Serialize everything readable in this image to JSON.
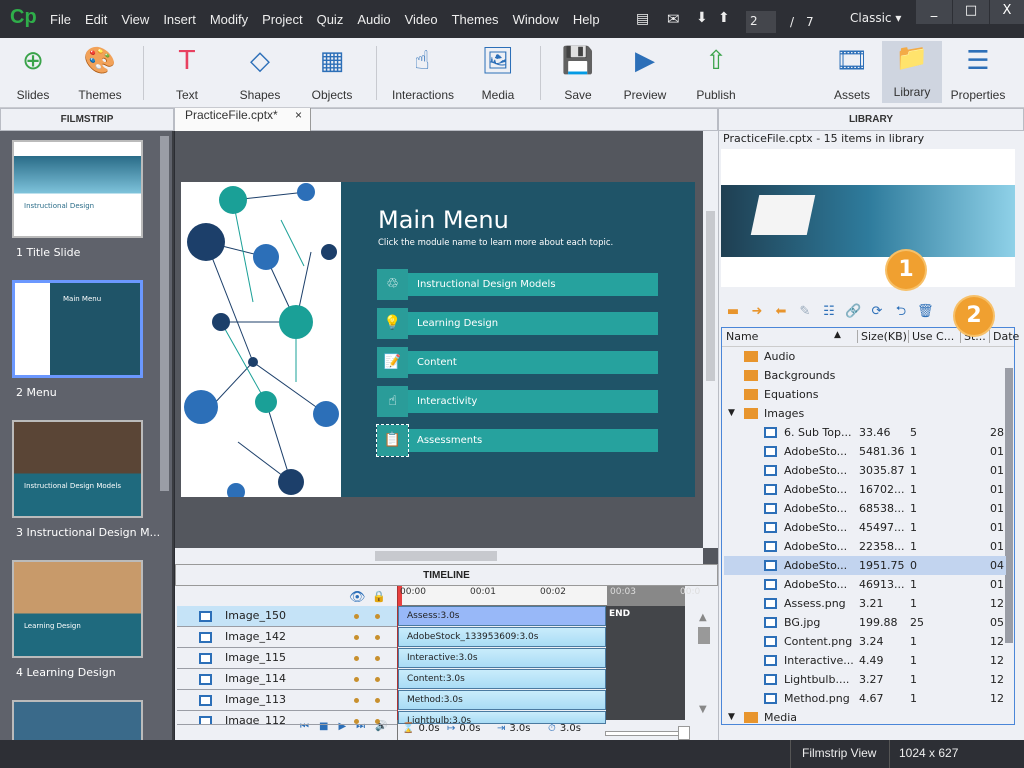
{
  "app": {
    "logo": "Cp",
    "menu": [
      "File",
      "Edit",
      "View",
      "Insert",
      "Modify",
      "Project",
      "Quiz",
      "Audio",
      "Video",
      "Themes",
      "Window",
      "Help"
    ],
    "page_current": "2",
    "page_sep": "/",
    "page_total": "7",
    "workspace": "Classic",
    "win": [
      "_",
      "□",
      "X"
    ]
  },
  "toolbar": {
    "items": [
      {
        "label": "Slides",
        "icon": "plus-circle-icon"
      },
      {
        "label": "Themes",
        "icon": "palette-icon"
      },
      {
        "label": "Text",
        "icon": "text-icon"
      },
      {
        "label": "Shapes",
        "icon": "shapes-icon"
      },
      {
        "label": "Objects",
        "icon": "objects-icon"
      },
      {
        "label": "Interactions",
        "icon": "hand-pointer-icon"
      },
      {
        "label": "Media",
        "icon": "image-icon"
      },
      {
        "label": "Save",
        "icon": "floppy-icon"
      },
      {
        "label": "Preview",
        "icon": "play-icon"
      },
      {
        "label": "Publish",
        "icon": "publish-icon"
      },
      {
        "label": "Assets",
        "icon": "assets-icon"
      },
      {
        "label": "Library",
        "icon": "library-icon"
      },
      {
        "label": "Properties",
        "icon": "properties-icon"
      }
    ]
  },
  "panels": {
    "filmstrip": "FILMSTRIP",
    "tab": "PracticeFile.cptx*",
    "tab_close": "×",
    "library": "LIBRARY",
    "timeline": "TIMELINE"
  },
  "filmstrip": [
    {
      "label": "1 Title Slide",
      "thumb_title": "Instructional Design"
    },
    {
      "label": "2 Menu",
      "thumb_title": "Main Menu"
    },
    {
      "label": "3 Instructional Design M...",
      "thumb_title": "Instructional Design Models"
    },
    {
      "label": "4 Learning Design",
      "thumb_title": "Learning Design"
    }
  ],
  "slide": {
    "title": "Main Menu",
    "subtitle": "Click the module name to learn more about each topic.",
    "buttons": [
      "Instructional Design Models",
      "Learning Design",
      "Content",
      "Interactivity",
      "Assessments"
    ]
  },
  "timeline": {
    "ticks": [
      "00:00",
      "00:01",
      "00:02",
      "00:03",
      "00:0"
    ],
    "end": "END",
    "rows": [
      {
        "name": "Image_150",
        "bar": "Assess:3.0s"
      },
      {
        "name": "Image_142",
        "bar": "AdobeStock_133953609:3.0s"
      },
      {
        "name": "Image_115",
        "bar": "Interactive:3.0s"
      },
      {
        "name": "Image_114",
        "bar": "Content:3.0s"
      },
      {
        "name": "Image_113",
        "bar": "Method:3.0s"
      },
      {
        "name": "Image_112",
        "bar": "Lightbulb:3.0s"
      }
    ],
    "times": [
      "0.0s",
      "0.0s",
      "3.0s",
      "3.0s"
    ]
  },
  "library": {
    "summary": "PracticeFile.cptx - 15 items in library",
    "columns": [
      "Name",
      "Size(KB)",
      "Use C...",
      "St...",
      "Date"
    ],
    "folders": [
      "Audio",
      "Backgrounds",
      "Equations",
      "Images"
    ],
    "items": [
      [
        "6. Sub Top...",
        "33.46",
        "5",
        "28"
      ],
      [
        "AdobeSto...",
        "5481.36",
        "1",
        "01"
      ],
      [
        "AdobeSto...",
        "3035.87",
        "1",
        "01"
      ],
      [
        "AdobeSto...",
        "16702...",
        "1",
        "01"
      ],
      [
        "AdobeSto...",
        "68538...",
        "1",
        "01"
      ],
      [
        "AdobeSto...",
        "45497...",
        "1",
        "01"
      ],
      [
        "AdobeSto...",
        "22358...",
        "1",
        "01"
      ],
      [
        "AdobeSto...",
        "1951.75",
        "0",
        "04"
      ],
      [
        "AdobeSto...",
        "46913...",
        "1",
        "01"
      ],
      [
        "Assess.png",
        "3.21",
        "1",
        "12"
      ],
      [
        "BG.jpg",
        "199.88",
        "25",
        "05"
      ],
      [
        "Content.png",
        "3.24",
        "1",
        "12"
      ],
      [
        "Interactive...",
        "4.49",
        "1",
        "12"
      ],
      [
        "Lightbulb....",
        "3.27",
        "1",
        "12"
      ],
      [
        "Method.png",
        "4.67",
        "1",
        "12"
      ]
    ],
    "selected_index": 7,
    "last_folder": "Media"
  },
  "callouts": [
    "1",
    "2"
  ],
  "status": {
    "view": "Filmstrip View",
    "size": "1024 x 627"
  },
  "colors": {
    "accent": "#f0a030",
    "slide_bg": "#1f5468",
    "button": "#26a29e",
    "selection": "#6b98ff"
  }
}
